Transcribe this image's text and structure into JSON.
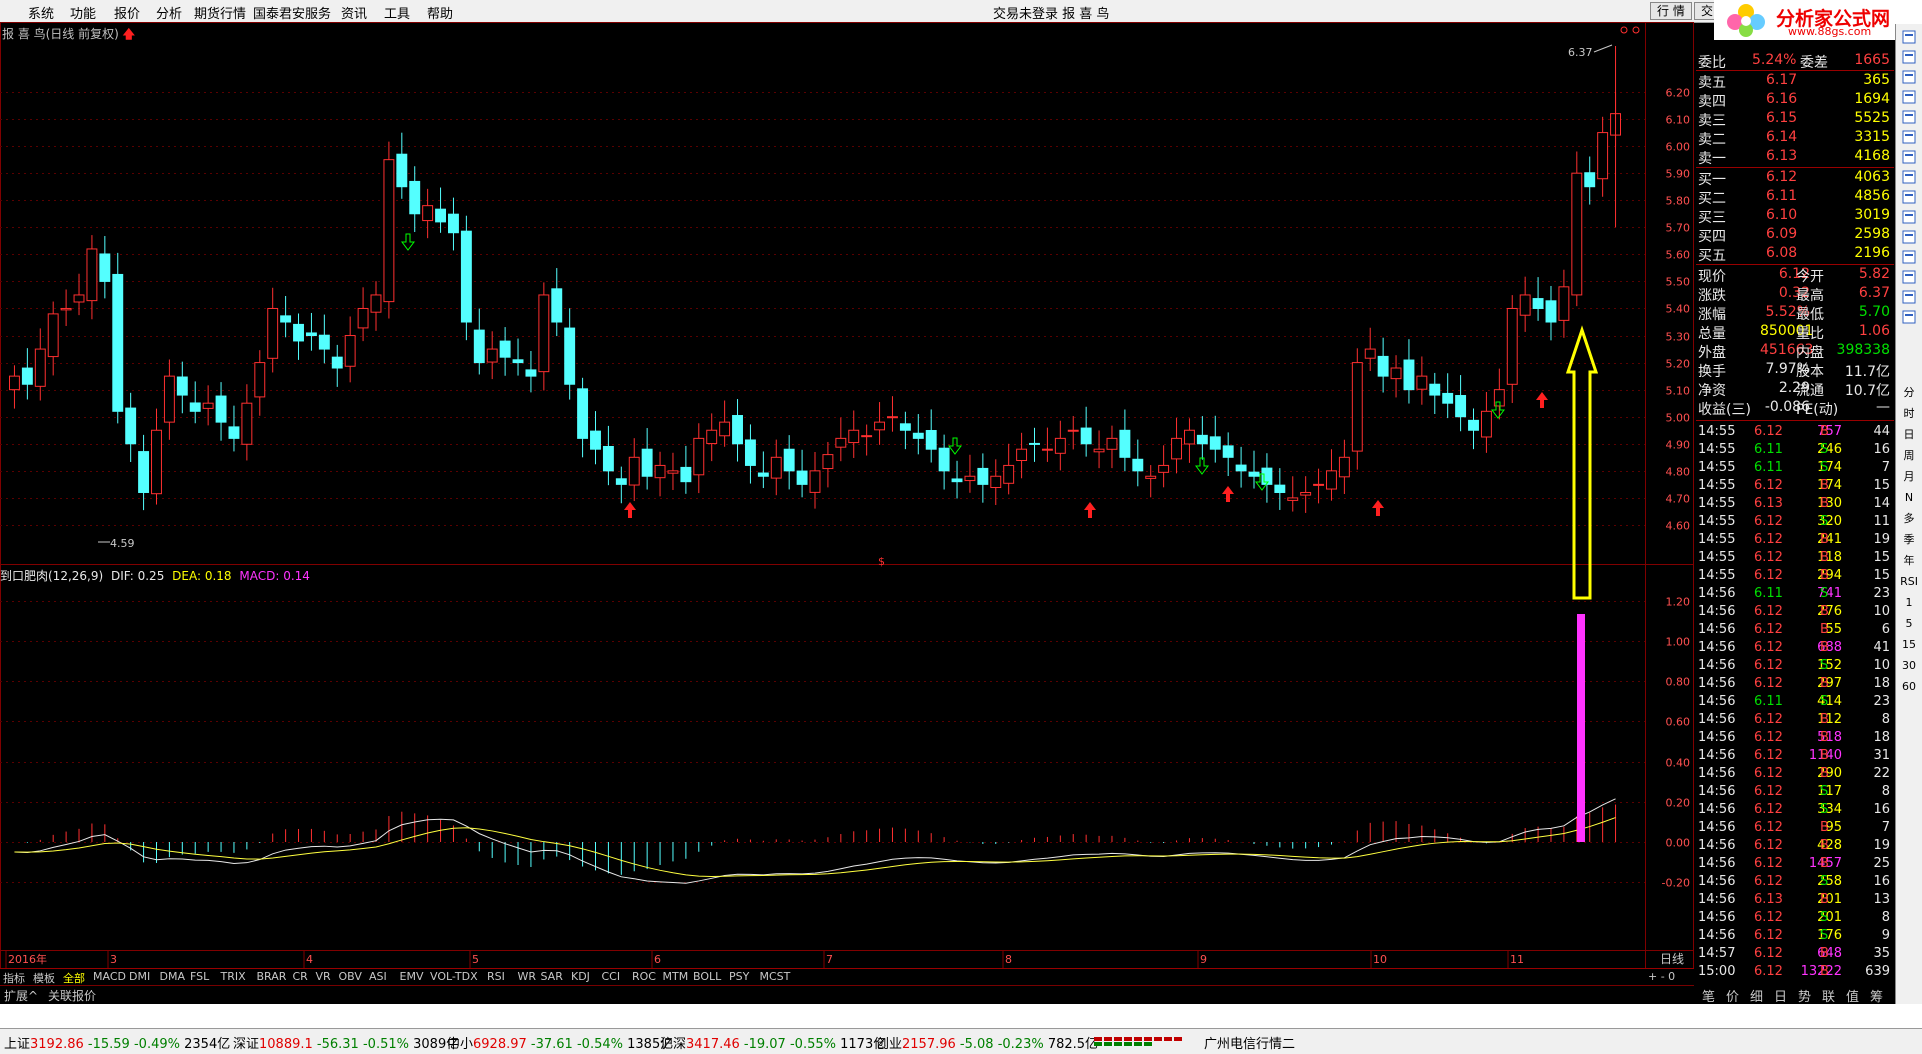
{
  "menu": {
    "items": [
      "系统",
      "功能",
      "报价",
      "分析",
      "期货行情",
      "国泰君安服务",
      "资讯",
      "工具",
      "帮助"
    ],
    "center_text": "交易未登录  报 喜 鸟",
    "btn_hangqing": "行 情",
    "btn_jiaoyi": "交 易"
  },
  "logo": {
    "name": "分析家公式网",
    "url": "www.88gs.com"
  },
  "kline": {
    "title": "报 喜 鸟(日线 前复权)",
    "high_label": "6.37",
    "low_label": "4.59",
    "price_ticks": [
      "6.20",
      "6.10",
      "6.00",
      "5.90",
      "5.80",
      "5.70",
      "5.60",
      "5.50",
      "5.40",
      "5.30",
      "5.20",
      "5.10",
      "5.00",
      "4.90",
      "4.80",
      "4.70",
      "4.60"
    ],
    "dollar_mark": "$"
  },
  "macd": {
    "name": "到口肥肉(12,26,9)",
    "dif_label": "DIF: 0.25",
    "dea_label": "DEA: 0.18",
    "macd_label": "MACD: 0.14",
    "ticks": [
      "1.20",
      "1.00",
      "0.80",
      "0.60",
      "0.40",
      "0.20",
      "0.00",
      "-0.20"
    ]
  },
  "x_axis": {
    "labels": [
      "2016年",
      "3",
      "4",
      "5",
      "6",
      "7",
      "8",
      "9",
      "10",
      "11"
    ],
    "period": "日线"
  },
  "colors": {
    "up": "#ff3030",
    "down": "#54ffff",
    "grid": "#800000",
    "dif": "#e8e8e8",
    "dea": "#ffff40",
    "macd_pos": "#ff3030",
    "macd_neg": "#54ffff",
    "arrow_yellow": "#ffff00",
    "bar_magenta": "#ff33ff"
  },
  "quote": {
    "weibi": {
      "label": "委比",
      "value": "5.24%",
      "label2": "委差",
      "value2": "1665"
    },
    "sell": [
      {
        "label": "卖五",
        "price": "6.17",
        "vol": "365"
      },
      {
        "label": "卖四",
        "price": "6.16",
        "vol": "1694"
      },
      {
        "label": "卖三",
        "price": "6.15",
        "vol": "5525"
      },
      {
        "label": "卖二",
        "price": "6.14",
        "vol": "3315"
      },
      {
        "label": "卖一",
        "price": "6.13",
        "vol": "4168"
      }
    ],
    "buy": [
      {
        "label": "买一",
        "price": "6.12",
        "vol": "4063"
      },
      {
        "label": "买二",
        "price": "6.11",
        "vol": "4856"
      },
      {
        "label": "买三",
        "price": "6.10",
        "vol": "3019"
      },
      {
        "label": "买四",
        "price": "6.09",
        "vol": "2598"
      },
      {
        "label": "买五",
        "price": "6.08",
        "vol": "2196"
      }
    ],
    "stats": [
      {
        "l1": "现价",
        "v1": "6.12",
        "l2": "今开",
        "v2": "5.82"
      },
      {
        "l1": "涨跌",
        "v1": "0.32",
        "l2": "最高",
        "v2": "6.37"
      },
      {
        "l1": "涨幅",
        "v1": "5.52%",
        "l2": "最低",
        "v2": "5.70"
      },
      {
        "l1": "总量",
        "v1": "850001",
        "l2": "量比",
        "v2": "1.06"
      },
      {
        "l1": "外盘",
        "v1": "451663",
        "l2": "内盘",
        "v2": "398338"
      },
      {
        "l1": "换手",
        "v1": "7.97%",
        "l2": "股本",
        "v2": "11.7亿"
      },
      {
        "l1": "净资",
        "v1": "2.29",
        "l2": "流通",
        "v2": "10.7亿"
      },
      {
        "l1": "收益(三)",
        "v1": "-0.086",
        "l2": "PE(动)",
        "v2": "—"
      }
    ]
  },
  "ticks": [
    {
      "t": "14:55",
      "p": "6.12",
      "v": "757",
      "s": "B",
      "n": "44"
    },
    {
      "t": "14:55",
      "p": "6.11",
      "v": "246",
      "s": "S",
      "n": "16"
    },
    {
      "t": "14:55",
      "p": "6.11",
      "v": "174",
      "s": "S",
      "n": "7"
    },
    {
      "t": "14:55",
      "p": "6.12",
      "v": "174",
      "s": "B",
      "n": "15"
    },
    {
      "t": "14:55",
      "p": "6.13",
      "v": "130",
      "s": "B",
      "n": "14"
    },
    {
      "t": "14:55",
      "p": "6.12",
      "v": "320",
      "s": "S",
      "n": "11"
    },
    {
      "t": "14:55",
      "p": "6.12",
      "v": "241",
      "s": "B",
      "n": "19"
    },
    {
      "t": "14:55",
      "p": "6.12",
      "v": "118",
      "s": "B",
      "n": "15"
    },
    {
      "t": "14:55",
      "p": "6.12",
      "v": "294",
      "s": "B",
      "n": "15"
    },
    {
      "t": "14:56",
      "p": "6.11",
      "v": "741",
      "s": "S",
      "n": "23"
    },
    {
      "t": "14:56",
      "p": "6.12",
      "v": "276",
      "s": "B",
      "n": "10"
    },
    {
      "t": "14:56",
      "p": "6.12",
      "v": "55",
      "s": "B",
      "n": "6"
    },
    {
      "t": "14:56",
      "p": "6.12",
      "v": "688",
      "s": "B",
      "n": "41"
    },
    {
      "t": "14:56",
      "p": "6.12",
      "v": "152",
      "s": "S",
      "n": "10"
    },
    {
      "t": "14:56",
      "p": "6.12",
      "v": "297",
      "s": "B",
      "n": "18"
    },
    {
      "t": "14:56",
      "p": "6.11",
      "v": "414",
      "s": "S",
      "n": "23"
    },
    {
      "t": "14:56",
      "p": "6.12",
      "v": "112",
      "s": "B",
      "n": "8"
    },
    {
      "t": "14:56",
      "p": "6.12",
      "v": "518",
      "s": "B",
      "n": "18"
    },
    {
      "t": "14:56",
      "p": "6.12",
      "v": "1140",
      "s": "B",
      "n": "31"
    },
    {
      "t": "14:56",
      "p": "6.12",
      "v": "290",
      "s": "B",
      "n": "22"
    },
    {
      "t": "14:56",
      "p": "6.12",
      "v": "117",
      "s": "S",
      "n": "8"
    },
    {
      "t": "14:56",
      "p": "6.12",
      "v": "334",
      "s": "S",
      "n": "16"
    },
    {
      "t": "14:56",
      "p": "6.12",
      "v": "95",
      "s": "B",
      "n": "7"
    },
    {
      "t": "14:56",
      "p": "6.12",
      "v": "428",
      "s": "B",
      "n": "19"
    },
    {
      "t": "14:56",
      "p": "6.12",
      "v": "1457",
      "s": "B",
      "n": "25"
    },
    {
      "t": "14:56",
      "p": "6.12",
      "v": "258",
      "s": "S",
      "n": "16"
    },
    {
      "t": "14:56",
      "p": "6.13",
      "v": "201",
      "s": "B",
      "n": "13"
    },
    {
      "t": "14:56",
      "p": "6.12",
      "v": "201",
      "s": "S",
      "n": "8"
    },
    {
      "t": "14:56",
      "p": "6.12",
      "v": "176",
      "s": "S",
      "n": "9"
    },
    {
      "t": "14:57",
      "p": "6.12",
      "v": "648",
      "s": "B",
      "n": "35"
    },
    {
      "t": "15:00",
      "p": "6.12",
      "v": "13222",
      "s": "B",
      "n": "639"
    }
  ],
  "indicator_tabs": [
    "指标",
    "模板",
    "全部",
    "MACD",
    "DMI",
    "DMA",
    "FSL",
    "TRIX",
    "BRAR",
    "CR",
    "VR",
    "OBV",
    "ASI",
    "EMV",
    "VOL-TDX",
    "RSI",
    "WR",
    "SAR",
    "KDJ",
    "CCI",
    "ROC",
    "MTM",
    "BOLL",
    "PSY",
    "MCST"
  ],
  "ext_tabs": [
    "扩展^",
    "关联报价"
  ],
  "right_tabs": [
    "笔",
    "价",
    "细",
    "日",
    "势",
    "联",
    "值",
    "筹"
  ],
  "sidebar_items": [
    "分",
    "时",
    "日",
    "周",
    "月",
    "N",
    "多",
    "季",
    "年",
    "RSI",
    "1",
    "5",
    "15",
    "30",
    "60"
  ],
  "status": {
    "sh": {
      "name": "上证",
      "val": "3192.86",
      "chg": "-15.59",
      "pct": "-0.49%",
      "amt": "2354亿"
    },
    "sz": {
      "name": "深证",
      "val": "10889.1",
      "chg": "-56.31",
      "pct": "-0.51%",
      "amt": "3089亿"
    },
    "zx": {
      "name": "中小",
      "val": "6928.97",
      "chg": "-37.61",
      "pct": "-0.54%",
      "amt": "1385亿"
    },
    "hs": {
      "name": "沪深",
      "val": "3417.46",
      "chg": "-19.07",
      "pct": "-0.55%",
      "amt": "1173亿"
    },
    "cy": {
      "name": "创业",
      "val": "2157.96",
      "chg": "-5.08",
      "pct": "-0.23%",
      "amt": "782.5亿"
    },
    "server": "广州电信行情二"
  }
}
